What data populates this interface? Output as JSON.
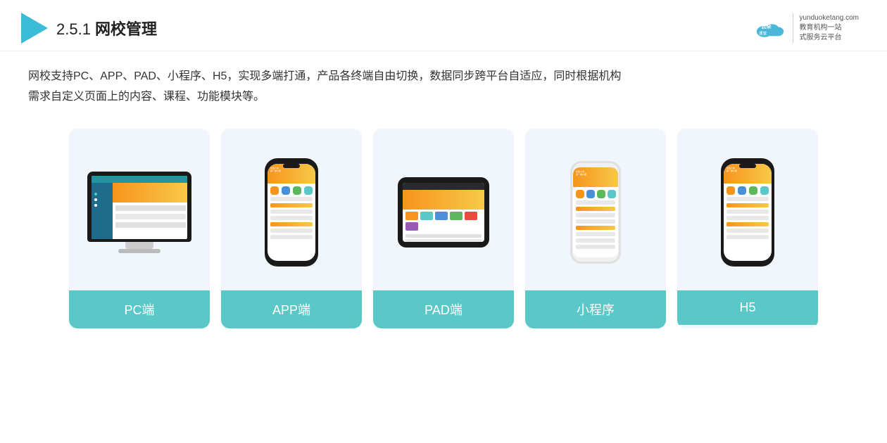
{
  "header": {
    "title_prefix": "2.5.1 ",
    "title_main": "网校管理",
    "brand_url": "yunduoketang.com",
    "brand_tagline1": "教育机构一站",
    "brand_tagline2": "式服务云平台"
  },
  "description": {
    "line1": "网校支持PC、APP、PAD、小程序、H5，实现多端打通，产品各终端自由切换，数据同步跨平台自适应，同时根据机构",
    "line2": "需求自定义页面上的内容、课程、功能模块等。"
  },
  "cards": [
    {
      "id": "pc",
      "label": "PC端"
    },
    {
      "id": "app",
      "label": "APP端"
    },
    {
      "id": "pad",
      "label": "PAD端"
    },
    {
      "id": "miniprogram",
      "label": "小程序"
    },
    {
      "id": "h5",
      "label": "H5"
    }
  ]
}
